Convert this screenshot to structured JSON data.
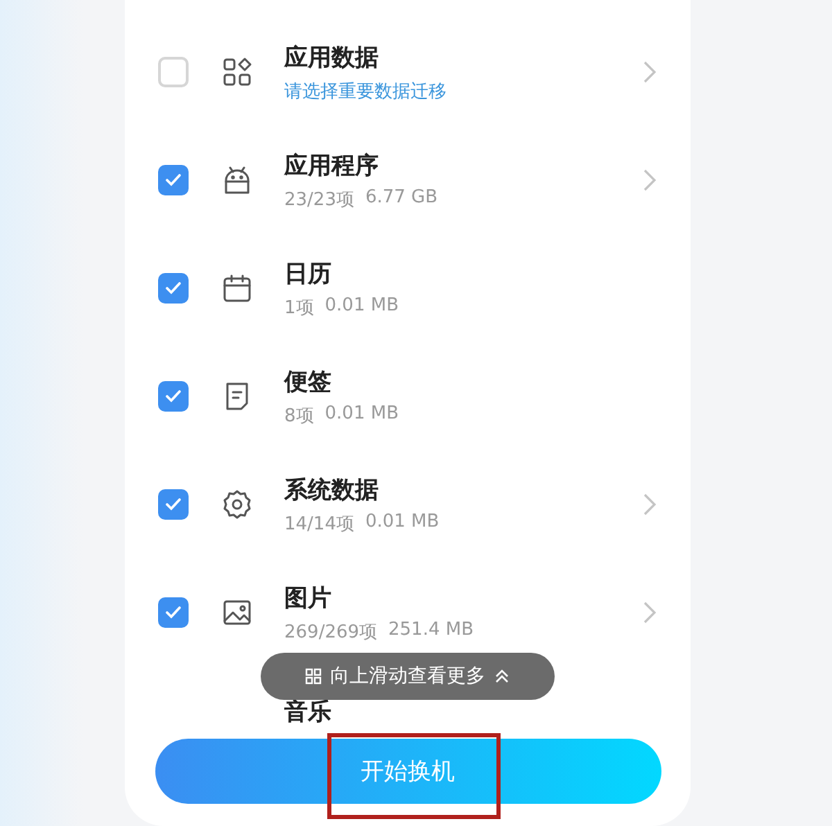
{
  "items": [
    {
      "kind": "apps",
      "title": "应用数据",
      "hint": "请选择重要数据迁移",
      "checked": false,
      "chevron": true
    },
    {
      "kind": "android",
      "title": "应用程序",
      "count": "23/23项",
      "size": "6.77 GB",
      "checked": true,
      "chevron": true
    },
    {
      "kind": "calendar",
      "title": "日历",
      "count": "1项",
      "size": "0.01 MB",
      "checked": true,
      "chevron": false
    },
    {
      "kind": "note",
      "title": "便签",
      "count": "8项",
      "size": "0.01 MB",
      "checked": true,
      "chevron": false
    },
    {
      "kind": "gear",
      "title": "系统数据",
      "count": "14/14项",
      "size": "0.01 MB",
      "checked": true,
      "chevron": true
    },
    {
      "kind": "image",
      "title": "图片",
      "count": "269/269项",
      "size": "251.4 MB",
      "checked": true,
      "chevron": true
    }
  ],
  "next_item": {
    "title": "音乐"
  },
  "toast": {
    "text": "向上滑动查看更多"
  },
  "start_button": {
    "label": "开始换机",
    "annotated": true
  }
}
